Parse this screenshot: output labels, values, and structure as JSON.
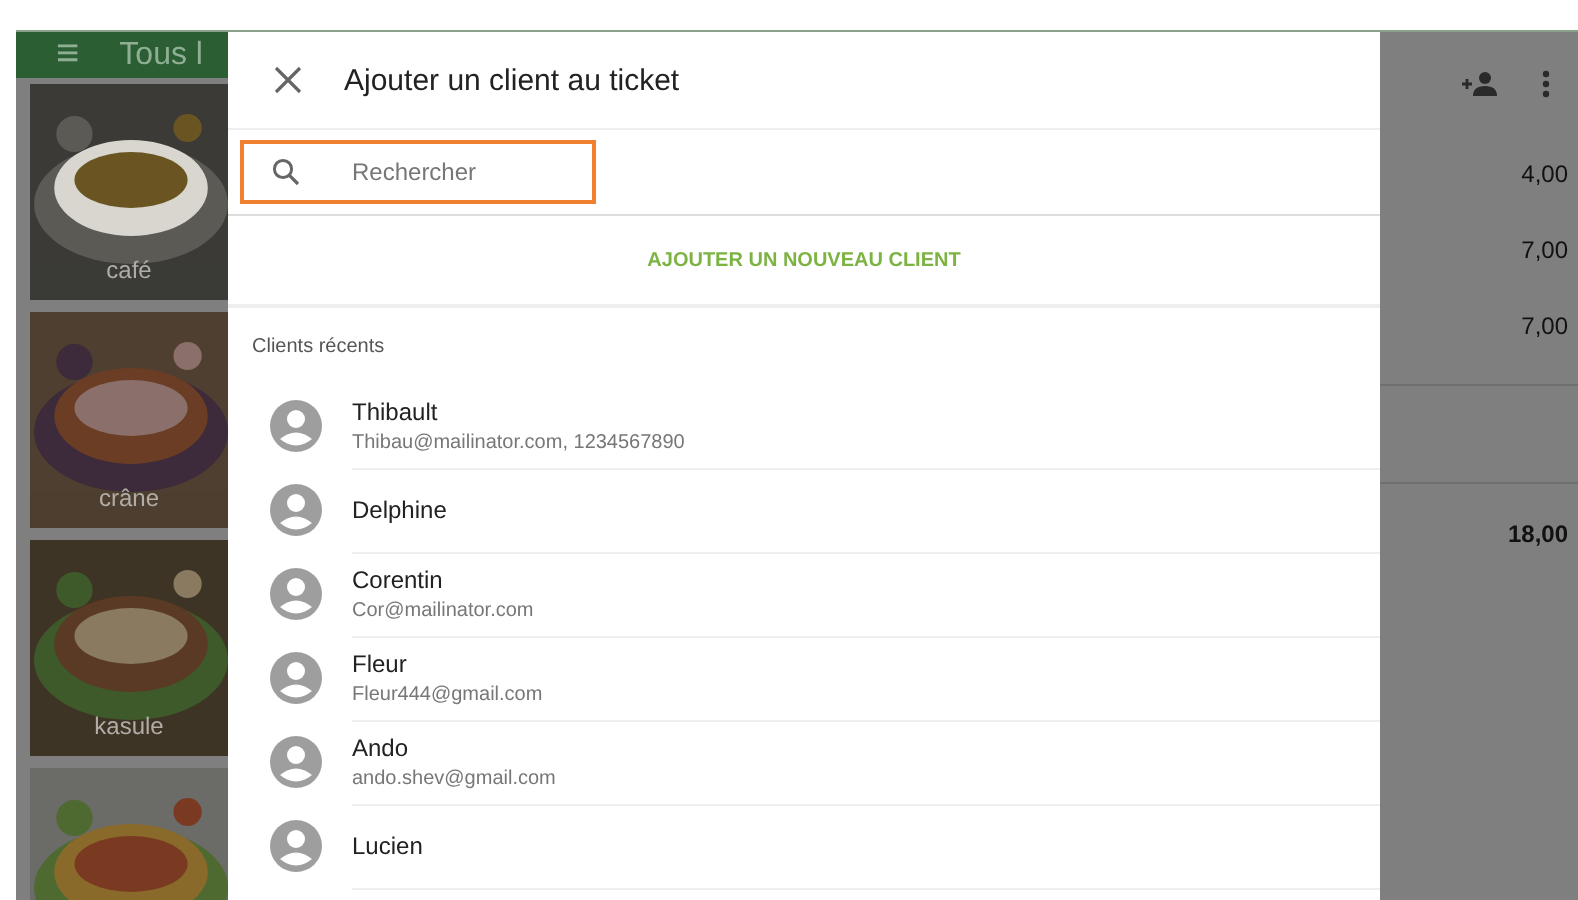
{
  "app_bar": {
    "menu_icon": "≡",
    "title": "Tous l"
  },
  "tiles": [
    {
      "label": "café",
      "kind": "soup"
    },
    {
      "label": "crâne",
      "kind": "terrine"
    },
    {
      "label": "kasule",
      "kind": "stew"
    },
    {
      "kind": "salad"
    }
  ],
  "ticket": {
    "prices": [
      {
        "value": "4,00",
        "kind": "line"
      },
      {
        "value": "7,00",
        "kind": "line"
      },
      {
        "value": "7,00",
        "kind": "line"
      },
      {
        "kind": "blank"
      },
      {
        "value": "18,00",
        "kind": "total"
      }
    ]
  },
  "dialog": {
    "title": "Ajouter un client au ticket",
    "search": {
      "placeholder": "Rechercher",
      "focused": true
    },
    "add_button": "AJOUTER UN NOUVEAU CLIENT",
    "section_label": "Clients récents",
    "clients": [
      {
        "name": "Thibault",
        "detail": "Thibau@mailinator.com, 1234567890"
      },
      {
        "name": "Delphine"
      },
      {
        "name": "Corentin",
        "detail": "Cor@mailinator.com"
      },
      {
        "name": "Fleur",
        "detail": "Fleur444@gmail.com"
      },
      {
        "name": "Ando",
        "detail": "ando.shev@gmail.com"
      },
      {
        "name": "Lucien"
      }
    ]
  }
}
